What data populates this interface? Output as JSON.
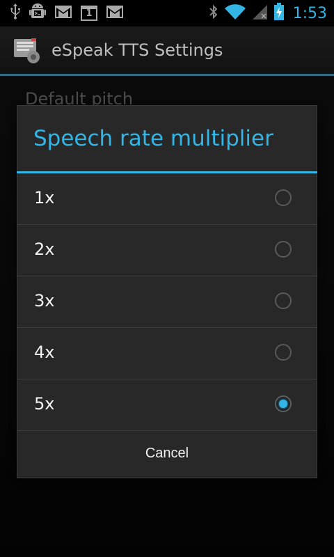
{
  "status_bar": {
    "left_icons": [
      "usb-icon",
      "android-debug-icon",
      "gmail-icon",
      "calendar-icon",
      "gmail-icon"
    ],
    "calendar_day": "1",
    "right_icons": [
      "bluetooth-icon",
      "wifi-icon",
      "signal-icon",
      "battery-charging-icon"
    ],
    "time": "1:53"
  },
  "app_bar": {
    "title": "eSpeak TTS Settings",
    "icon": "espeak-app-icon"
  },
  "background": {
    "pref_title": "Default pitch"
  },
  "dialog": {
    "title": "Speech rate multiplier",
    "options": [
      {
        "label": "1x",
        "checked": false
      },
      {
        "label": "2x",
        "checked": false
      },
      {
        "label": "3x",
        "checked": false
      },
      {
        "label": "4x",
        "checked": false
      },
      {
        "label": "5x",
        "checked": true
      }
    ],
    "cancel_label": "Cancel"
  },
  "colors": {
    "accent": "#33b5e5",
    "dialog_bg": "#282828",
    "divider": "#3d3d3d"
  }
}
